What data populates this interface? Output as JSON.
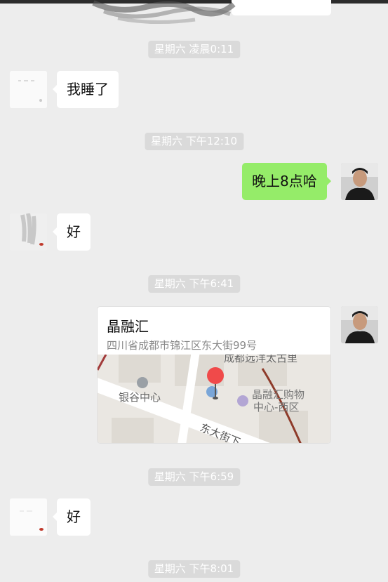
{
  "timestamps": {
    "t1": "星期六 凌晨0:11",
    "t2": "星期六 下午12:10",
    "t3": "星期六 下午6:41",
    "t4": "星期六 下午6:59",
    "t5": "星期六 下午8:01"
  },
  "messages": {
    "m1": "我睡了",
    "m2": "晚上8点哈",
    "m3": "好",
    "m5": "好"
  },
  "location": {
    "name": "晶融汇",
    "address": "四川省成都市锦江区东大街99号",
    "map_labels": {
      "poi1": "银谷中心",
      "poi2_line1": "晶融汇购物",
      "poi2_line2": "中心-西区",
      "street": "东大街下",
      "top_label": "成都远洋太古里"
    }
  },
  "colors": {
    "background": "#ededed",
    "bubble_in": "#ffffff",
    "bubble_out": "#95ec69",
    "timestamp_bg": "#dadada",
    "pin": "#f04a4a"
  }
}
